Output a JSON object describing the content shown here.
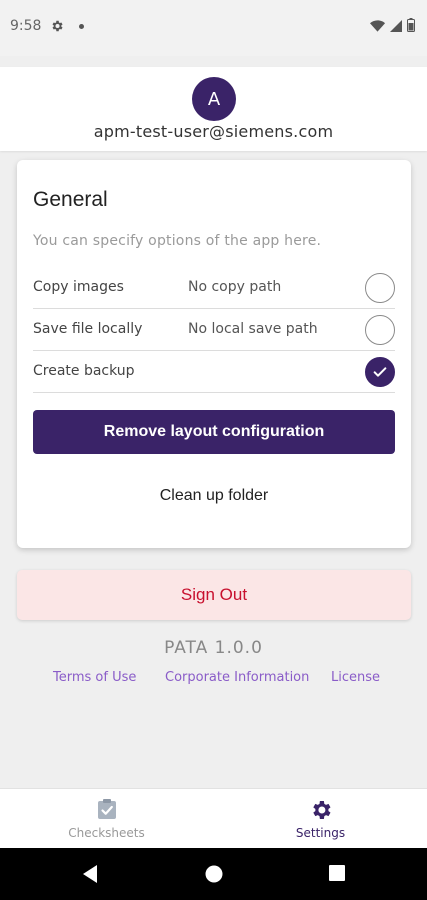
{
  "status_bar": {
    "time": "9:58"
  },
  "header": {
    "avatar_letter": "A",
    "email": "apm-test-user@siemens.com"
  },
  "general": {
    "title": "General",
    "description": "You can specify options of the app here.",
    "options": [
      {
        "label": "Copy images",
        "path": "No copy path",
        "checked": false
      },
      {
        "label": "Save file locally",
        "path": "No local save path",
        "checked": false
      },
      {
        "label": "Create backup",
        "path": "",
        "checked": true
      }
    ],
    "remove_layout_label": "Remove layout configuration",
    "clean_up_label": "Clean up folder"
  },
  "sign_out_label": "Sign Out",
  "version": "PATA 1.0.0",
  "links": {
    "terms": "Terms of Use",
    "corporate": "Corporate Information",
    "license": "License"
  },
  "bottom_nav": {
    "checksheets": "Checksheets",
    "settings": "Settings"
  },
  "colors": {
    "primary": "#3a2368",
    "danger": "#c8102e",
    "link": "#8a5cc8",
    "signout_bg": "#fbe6e6"
  }
}
